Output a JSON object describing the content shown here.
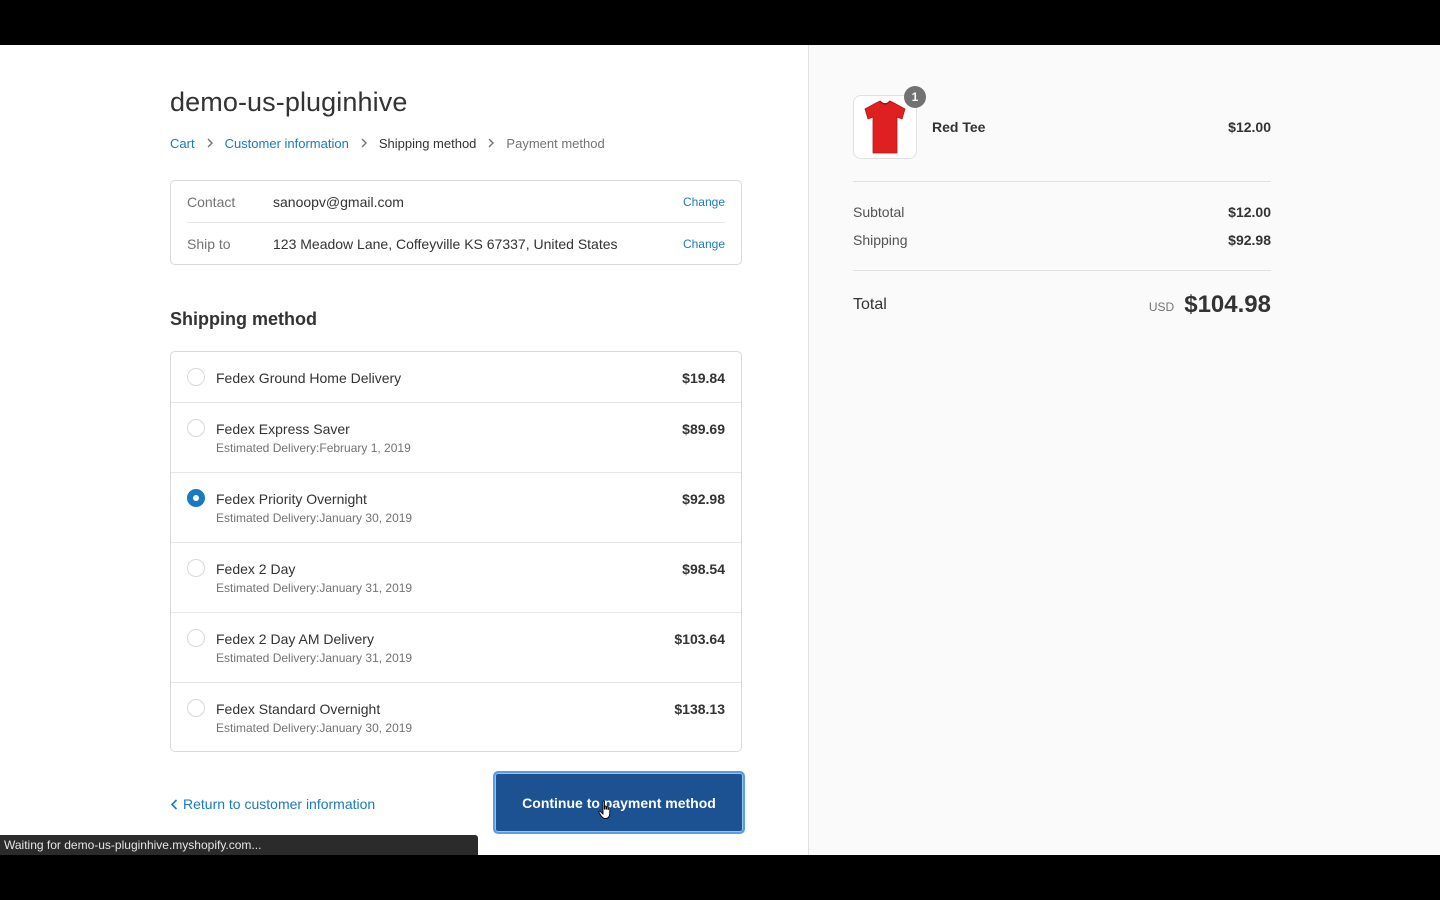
{
  "store": {
    "name": "demo-us-pluginhive"
  },
  "breadcrumb": {
    "cart": "Cart",
    "customer_information": "Customer information",
    "shipping_method": "Shipping method",
    "payment_method": "Payment method"
  },
  "review": {
    "contact_label": "Contact",
    "contact_value": "sanoopv@gmail.com",
    "ship_to_label": "Ship to",
    "ship_to_value": "123 Meadow Lane, Coffeyville KS 67337, United States",
    "change_label": "Change"
  },
  "shipping": {
    "title": "Shipping method",
    "selected_index": 2,
    "methods": [
      {
        "name": "Fedex Ground Home Delivery",
        "delivery": "",
        "price": "$19.84"
      },
      {
        "name": "Fedex Express Saver",
        "delivery": "Estimated Delivery:February 1, 2019",
        "price": "$89.69"
      },
      {
        "name": "Fedex Priority Overnight",
        "delivery": "Estimated Delivery:January 30, 2019",
        "price": "$92.98"
      },
      {
        "name": "Fedex 2 Day",
        "delivery": "Estimated Delivery:January 31, 2019",
        "price": "$98.54"
      },
      {
        "name": "Fedex 2 Day AM Delivery",
        "delivery": "Estimated Delivery:January 31, 2019",
        "price": "$103.64"
      },
      {
        "name": "Fedex Standard Overnight",
        "delivery": "Estimated Delivery:January 30, 2019",
        "price": "$138.13"
      }
    ]
  },
  "actions": {
    "back_label": "Return to customer information",
    "continue_label": "Continue to payment method"
  },
  "status_bar": {
    "text": "Waiting for demo-us-pluginhive.myshopify.com..."
  },
  "summary": {
    "product": {
      "name": "Red Tee",
      "price": "$12.00",
      "quantity": "1"
    },
    "subtotal_label": "Subtotal",
    "subtotal_value": "$12.00",
    "shipping_label": "Shipping",
    "shipping_value": "$92.98",
    "total_label": "Total",
    "currency": "USD",
    "total_value": "$104.98"
  },
  "colors": {
    "link": "#197bbd",
    "primary_button": "#1c5291",
    "tshirt": "#e02020"
  }
}
